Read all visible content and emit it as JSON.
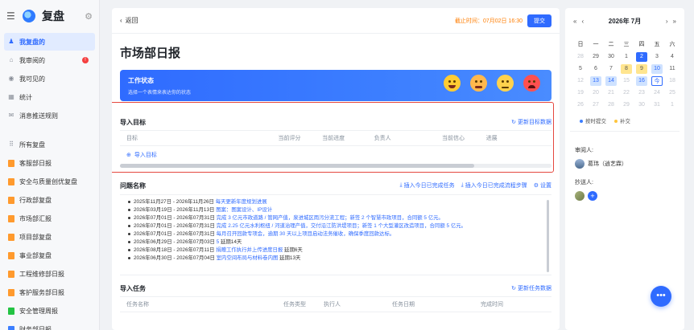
{
  "app": {
    "title": "复盘"
  },
  "sidebar": {
    "items_top": [
      {
        "label": "我复盘的",
        "icon": "person-icon",
        "active": true
      },
      {
        "label": "我审阅的",
        "icon": "review-icon",
        "badge": "!"
      },
      {
        "label": "我可见的",
        "icon": "eye-icon"
      },
      {
        "label": "统计",
        "icon": "chart-icon"
      },
      {
        "label": "消息推送规则",
        "icon": "message-icon"
      }
    ],
    "section_label": "所有复盘",
    "items_bottom": [
      {
        "label": "客服部日报",
        "color": "orange"
      },
      {
        "label": "安全与质量创优复盘",
        "color": "orange"
      },
      {
        "label": "行政部复盘",
        "color": "orange"
      },
      {
        "label": "市场部汇报",
        "color": "orange"
      },
      {
        "label": "项目部复盘",
        "color": "orange"
      },
      {
        "label": "事业部复盘",
        "color": "orange"
      },
      {
        "label": "工程维修部日报",
        "color": "orange"
      },
      {
        "label": "客护服务部日报",
        "color": "orange"
      },
      {
        "label": "安全管理周报",
        "color": "green"
      },
      {
        "label": "财务部日报",
        "color": "blue"
      }
    ]
  },
  "main": {
    "back_label": "返回",
    "deadline": "截止时间：07月02日 16:30",
    "submit_label": "提交",
    "page_title": "市场部日报",
    "banner": {
      "title": "工作状态",
      "subtitle": "选择一个表情来表达你的状态"
    },
    "import_goals": {
      "title": "导入目标",
      "update_link": "更新目标数据",
      "columns": [
        "目标",
        "当前评分",
        "当前进度",
        "负责人",
        "当前信心",
        "进展"
      ],
      "add_label": "导入目标"
    },
    "questions": {
      "title": "问题名称",
      "action1": "插入今日已完成任务",
      "action2": "插入今日已完成流程步骤",
      "action3": "设置",
      "items": [
        {
          "date": "2025年11月27日 - 2026年11月26日",
          "link": "每天更新年度规划进展",
          "extra": ""
        },
        {
          "date": "2026年03月19日 - 2026年11月13日",
          "link": "图案：图案设计、IP设计",
          "extra": ""
        },
        {
          "date": "2026年07月01日 - 2026年07月31日",
          "link": "完成 3 亿元市政道路 / 管网产值，泉进城区雨污分流工程；新签 2 个智慧市政项目，合同额 5 亿元。",
          "extra": ""
        },
        {
          "date": "2026年07月01日 - 2026年07月31日",
          "link": "完成 2.25 亿元水利枢纽 / 河道治理产值，交付沿江防洪堤项目；新签 1 个大型灌区改造项目，合同额 5 亿元。",
          "extra": ""
        },
        {
          "date": "2026年07月01日 - 2026年07月31日",
          "link": "每月召开回款专项会，逾期 30 天以上项目启动法务催收，确保季度回款达标。",
          "extra": ""
        },
        {
          "date": "2026年06月29日 - 2026年07月03日",
          "link": "5",
          "extra": " 延期14天"
        },
        {
          "date": "2026年08月18日 - 2026年07月11日",
          "link": "捐赠工作执行并上传进度日报",
          "extra": " 延期6天"
        },
        {
          "date": "2026年06月30日 - 2026年07月04日",
          "link": "室内空间布局与材料卷内图",
          "extra": " 延期13天"
        }
      ]
    },
    "import_tasks": {
      "title": "导入任务",
      "update_link": "更新任务数据",
      "columns": [
        "任务名称",
        "任务类型",
        "执行人",
        "任务日期",
        "完成时间"
      ]
    }
  },
  "calendar": {
    "month": "2026年 7月",
    "weekdays": [
      "日",
      "一",
      "二",
      "三",
      "四",
      "五",
      "六"
    ],
    "days": [
      {
        "d": "28",
        "s": "dim"
      },
      {
        "d": "29",
        "s": ""
      },
      {
        "d": "30",
        "s": ""
      },
      {
        "d": "1",
        "s": ""
      },
      {
        "d": "2",
        "s": "today"
      },
      {
        "d": "3",
        "s": ""
      },
      {
        "d": "4",
        "s": ""
      },
      {
        "d": "5",
        "s": ""
      },
      {
        "d": "6",
        "s": ""
      },
      {
        "d": "7",
        "s": ""
      },
      {
        "d": "8",
        "s": "yel"
      },
      {
        "d": "9",
        "s": "yel"
      },
      {
        "d": "10",
        "s": "blu"
      },
      {
        "d": "11",
        "s": ""
      },
      {
        "d": "12",
        "s": "dim"
      },
      {
        "d": "13",
        "s": "blu"
      },
      {
        "d": "14",
        "s": "blu"
      },
      {
        "d": "15",
        "s": "dim"
      },
      {
        "d": "16",
        "s": "blu"
      },
      {
        "d": "今",
        "s": "outl"
      },
      {
        "d": "18",
        "s": "dim"
      },
      {
        "d": "19",
        "s": "dim"
      },
      {
        "d": "20",
        "s": "dim"
      },
      {
        "d": "21",
        "s": "dim"
      },
      {
        "d": "22",
        "s": "dim"
      },
      {
        "d": "23",
        "s": "dim"
      },
      {
        "d": "24",
        "s": "dim"
      },
      {
        "d": "25",
        "s": "dim"
      },
      {
        "d": "26",
        "s": "dim"
      },
      {
        "d": "27",
        "s": "dim"
      },
      {
        "d": "28",
        "s": "dim"
      },
      {
        "d": "29",
        "s": "dim"
      },
      {
        "d": "30",
        "s": "dim"
      },
      {
        "d": "31",
        "s": "dim"
      },
      {
        "d": "1",
        "s": "dim"
      }
    ],
    "legend_ontime": "按时提交",
    "legend_late": "补交",
    "legend_colors": {
      "ontime": "#3c7eff",
      "late": "#ffc53d"
    }
  },
  "review": {
    "label": "审阅人:",
    "person": "葛玮（逍艺霖）"
  },
  "cc": {
    "label": "抄送人:"
  },
  "colors": {
    "accent": "#2f6bff",
    "alert": "#e5483f",
    "deadline": "#ff7d00"
  }
}
